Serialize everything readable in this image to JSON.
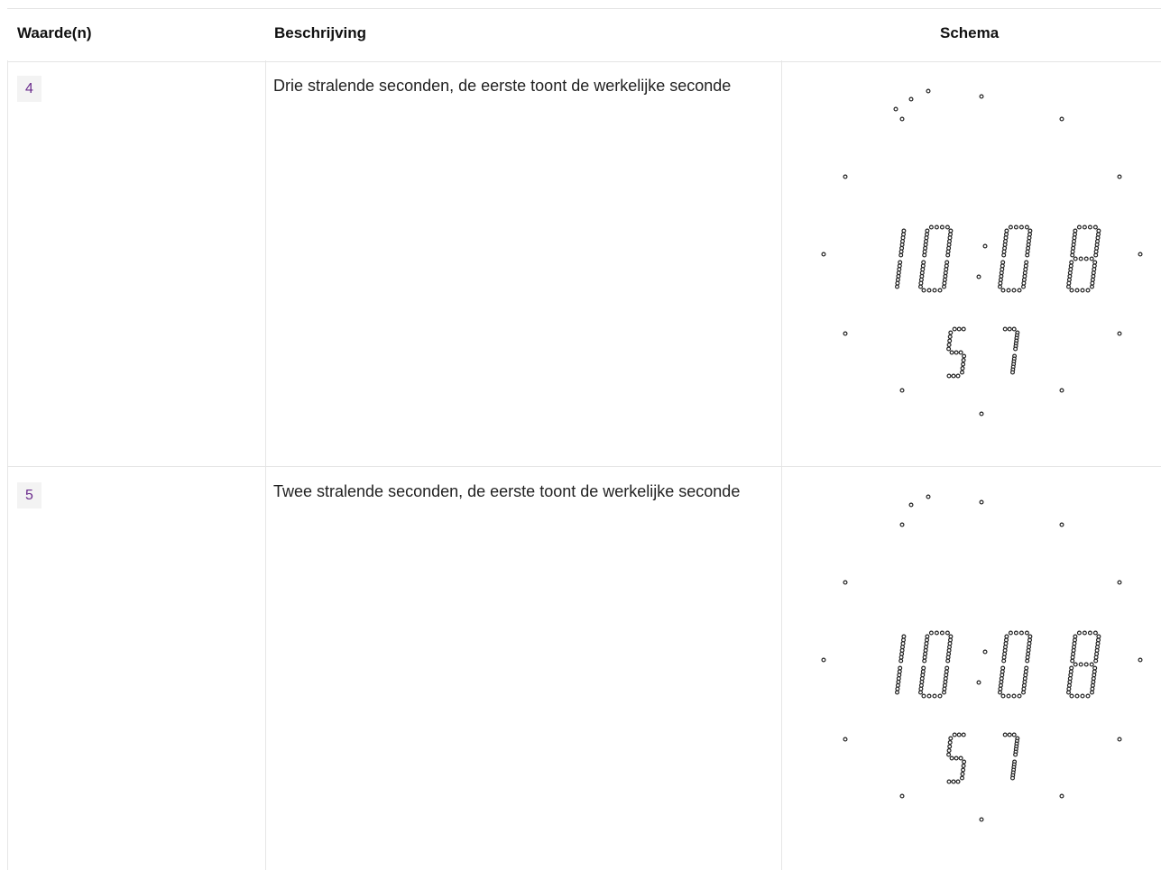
{
  "table": {
    "headers": {
      "value": "Waarde(n)",
      "description": "Beschrijving",
      "schema": "Schema"
    },
    "rows": [
      {
        "value": "4",
        "description": "Drie stralende seconden, de eerste toont de werkelijke seconde",
        "clock_hours": "10",
        "clock_minutes": "08",
        "clock_seconds": "57",
        "radiant_seconds": 3
      },
      {
        "value": "5",
        "description": "Twee stralende seconden, de eerste toont de werkelijke seconde",
        "clock_hours": "10",
        "clock_minutes": "08",
        "clock_seconds": "57",
        "radiant_seconds": 2
      }
    ]
  }
}
